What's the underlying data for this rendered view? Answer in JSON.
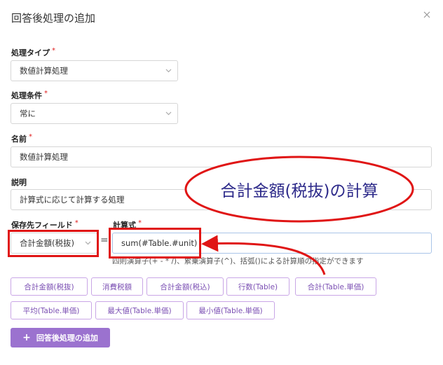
{
  "dialog": {
    "title": "回答後処理の追加"
  },
  "fields": {
    "type": {
      "label": "処理タイプ",
      "value": "数値計算処理"
    },
    "condition": {
      "label": "処理条件",
      "value": "常に"
    },
    "name": {
      "label": "名前",
      "value": "数値計算処理"
    },
    "description": {
      "label": "説明",
      "value": "計算式に応じて計算する処理"
    },
    "save_field": {
      "label": "保存先フィールド",
      "value": "合計金額(税抜)"
    },
    "formula": {
      "label": "計算式",
      "value": "sum(#Table.#unit)"
    }
  },
  "required_mark": "*",
  "equals": "=",
  "hint": "四則演算子(+ - * /)、累乗演算子(^)、括弧()による計算順の指定ができます",
  "chips": [
    "合計金額(税抜)",
    "消費税額",
    "合計金額(税込)",
    "行数(Table)",
    "合計(Table.単価)",
    "平均(Table.単価)",
    "最大値(Table.単価)",
    "最小値(Table.単価)"
  ],
  "add_button": {
    "label": "回答後処理の追加"
  },
  "callout": {
    "text": "合計金額(税抜)の計算"
  },
  "colors": {
    "accent": "#9b72cf",
    "chip_text": "#7b4fb3",
    "annotation_red": "#e01515",
    "callout_text": "#2d2a8a"
  }
}
